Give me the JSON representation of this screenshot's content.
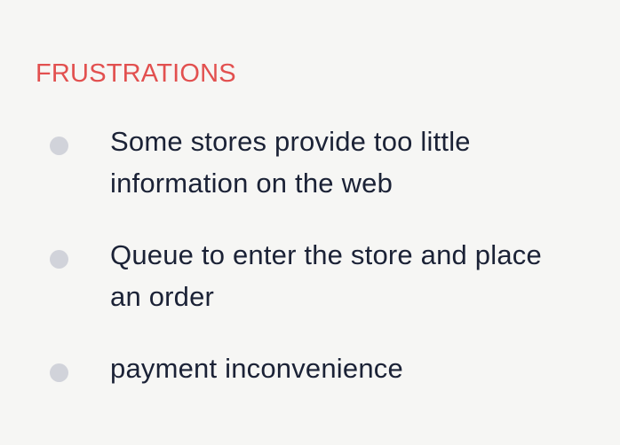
{
  "section": {
    "title": "FRUSTRATIONS",
    "accent_color": "#e2504f",
    "bullet_color": "#d1d3da",
    "text_color": "#1b2236",
    "background_color": "#f6f6f4"
  },
  "items": [
    {
      "text": "Some stores provide too little information on the web"
    },
    {
      "text": "Queue to enter the store and place an order"
    },
    {
      "text": "payment inconvenience"
    }
  ]
}
